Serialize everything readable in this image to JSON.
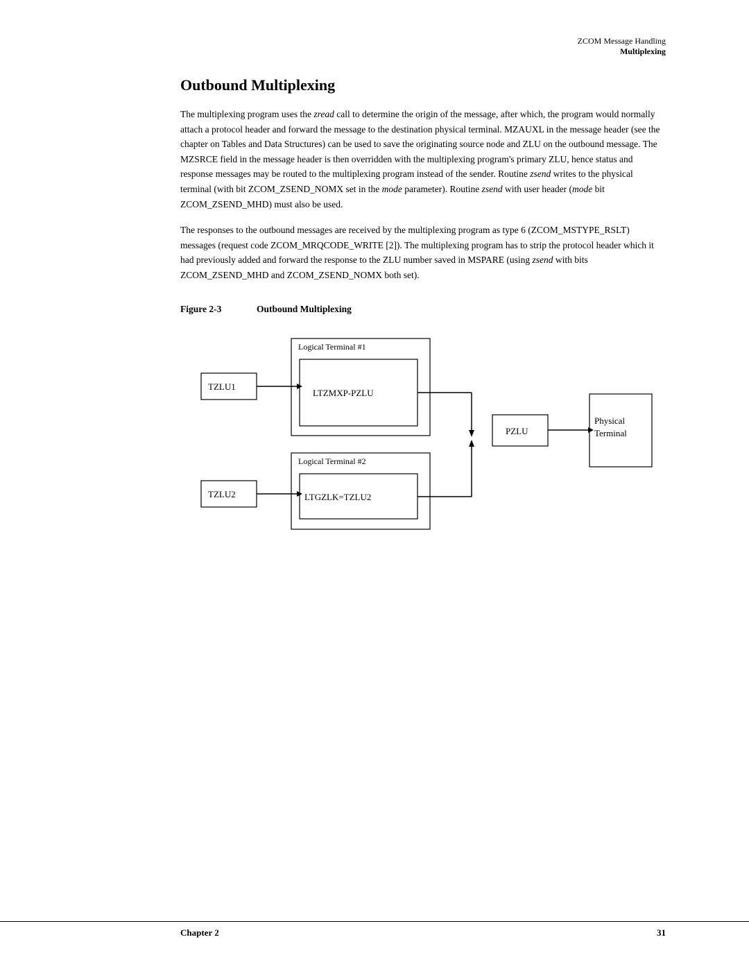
{
  "header": {
    "chapter_label": "ZCOM Message Handling",
    "section_label": "Multiplexing"
  },
  "section": {
    "title": "Outbound Multiplexing",
    "paragraph1": "The multiplexing program uses the zread call to determine the origin of the message, after which, the program would normally attach a protocol header and forward the message to the destination physical terminal. MZAUXL in the message header (see the chapter on Tables and Data Structures) can be used to save the originating source node and ZLU on the outbound message. The MZSRCE field in the message header is then overridden with the multiplexing program's primary ZLU, hence status and response messages may be routed to the multiplexing program instead of the sender. Routine zsend writes to the physical terminal (with bit ZCOM_ZSEND_NOMX set in the mode parameter). Routine zsend with user header (mode bit ZCOM_ZSEND_MHD) must also be used.",
    "paragraph1_italic_words": [
      "zread",
      "zsend",
      "mode",
      "zsend",
      "mode"
    ],
    "paragraph2": "The responses to the outbound messages are received by the multiplexing program as type 6 (ZCOM_MSTYPE_RSLT) messages (request code ZCOM_MRQCODE_WRITE [2]). The multiplexing program has to strip the protocol header which it had previously added and forward the response to the ZLU number saved in MSPARE (using zsend with bits ZCOM_ZSEND_MHD and ZCOM_ZSEND_NOMX both set).",
    "paragraph2_italic_words": [
      "zsend"
    ]
  },
  "figure": {
    "label": "Figure 2-3",
    "title": "Outbound Multiplexing",
    "nodes": {
      "tzlu1": "TZLU1",
      "tzlu2": "TZLU2",
      "logical1_label": "Logical Terminal #1",
      "logical2_label": "Logical Terminal #2",
      "ltzmxp": "LTZMXP-PZLU",
      "ltgzlk": "LTGZLK=TZLU2",
      "pzlu": "PZLU",
      "physical": "Physical\nTerminal"
    }
  },
  "footer": {
    "left_label": "Chapter 2",
    "right_label": "31"
  }
}
